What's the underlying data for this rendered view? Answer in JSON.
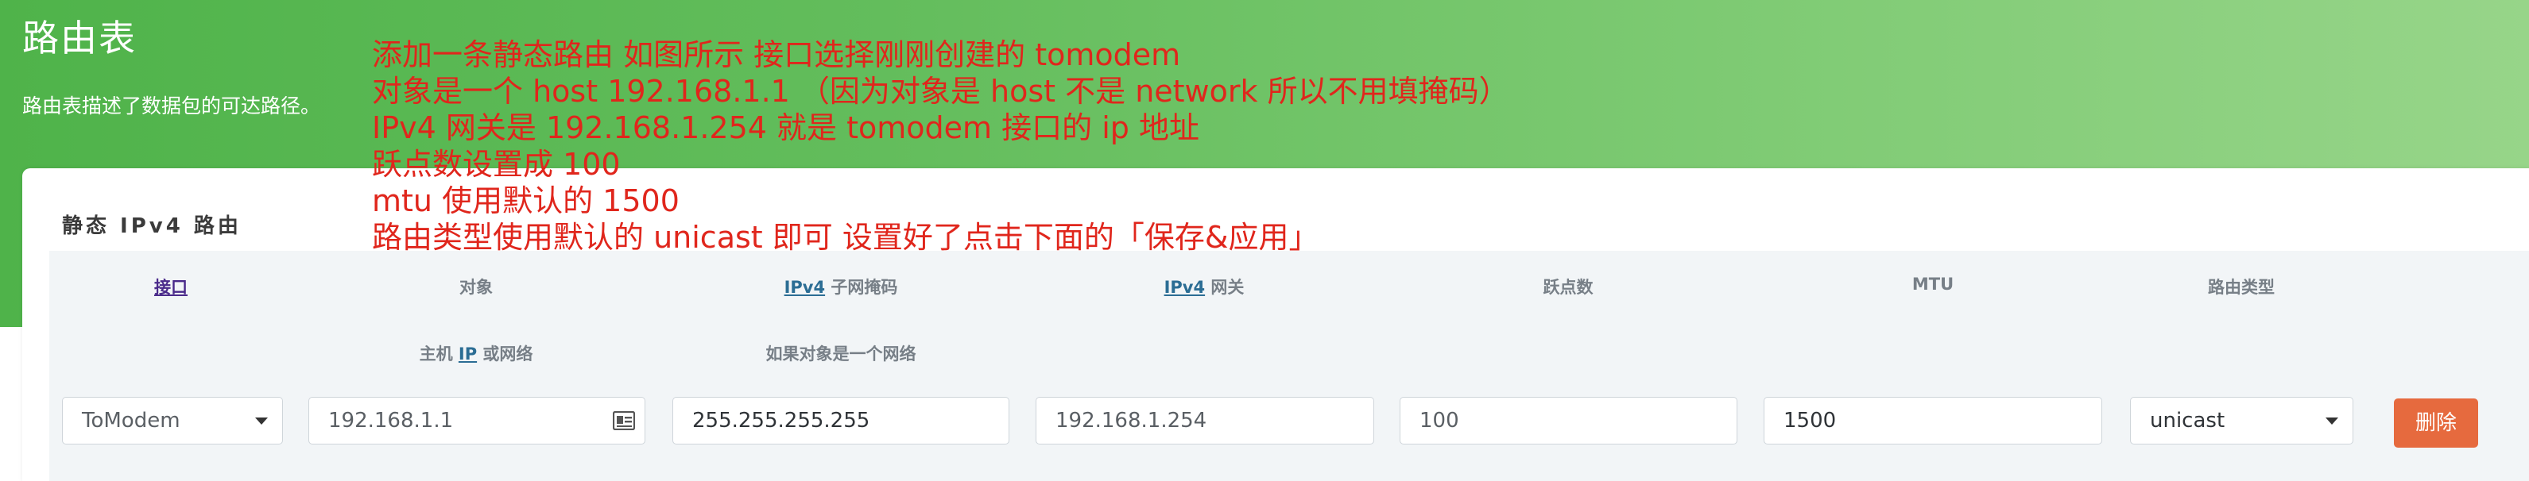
{
  "header": {
    "title": "路由表",
    "description": "路由表描述了数据包的可达路径。"
  },
  "section": {
    "title": "静态 IPv4 路由"
  },
  "columns": {
    "interface": "接口",
    "target": "对象",
    "target_sub_pre": "主机 ",
    "target_sub_abbr": "IP",
    "target_sub_post": " 或网络",
    "netmask_abbr": "IPv4",
    "netmask": " 子网掩码",
    "netmask_sub": "如果对象是一个网络",
    "gateway_abbr": "IPv4",
    "gateway": " 网关",
    "metric": "跃点数",
    "mtu": "MTU",
    "route_type": "路由类型"
  },
  "row": {
    "interface_value": "ToModem",
    "target_placeholder": "192.168.1.1",
    "netmask_value": "255.255.255.255",
    "gateway_placeholder": "192.168.1.254",
    "metric_placeholder": "100",
    "mtu_value": "1500",
    "route_type_value": "unicast",
    "delete_label": "删除"
  },
  "annotation": {
    "lines": [
      "添加一条静态路由 如图所示 接口选择刚刚创建的 tomodem",
      "对象是一个 host 192.168.1.1 （因为对象是 host 不是 network 所以不用填掩码）",
      "IPv4 网关是 192.168.1.254 就是 tomodem 接口的 ip 地址",
      "跃点数设置成 100",
      "mtu 使用默认的 1500",
      "路由类型使用默认的 unicast 即可 设置好了点击下面的「保存&应用」"
    ]
  },
  "colors": {
    "header_green": "#5cb85c",
    "annotation_red": "#e0261c",
    "delete_orange": "#e66a3e"
  },
  "icons": [
    "chevron-down-icon",
    "address-card-icon"
  ]
}
